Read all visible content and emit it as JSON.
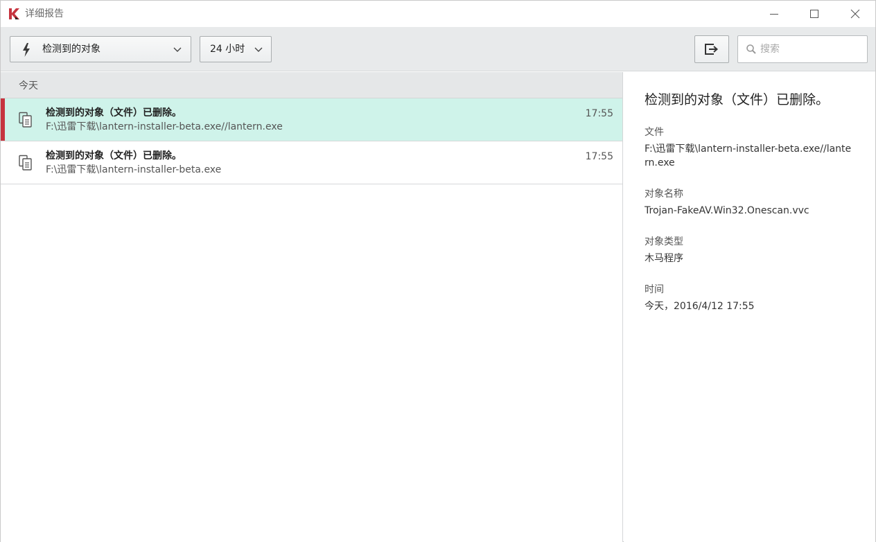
{
  "window": {
    "title": "详细报告",
    "colors": {
      "logo_red": "#c6343f",
      "selection": "#cff3ea",
      "toolbar": "#e8eaeb"
    }
  },
  "toolbar": {
    "type_filter": {
      "icon": "lightning-bolt-icon",
      "label": "检测到的对象"
    },
    "time_filter": {
      "label": "24 小时"
    },
    "export_icon": "export-icon",
    "search": {
      "placeholder": "搜索",
      "value": ""
    }
  },
  "list": {
    "group_label": "今天",
    "rows": [
      {
        "title": "检测到的对象（文件）已删除。",
        "path": "F:\\迅雷下载\\lantern-installer-beta.exe//lantern.exe",
        "time": "17:55",
        "selected": true
      },
      {
        "title": "检测到的对象（文件）已删除。",
        "path": "F:\\迅雷下载\\lantern-installer-beta.exe",
        "time": "17:55",
        "selected": false
      }
    ]
  },
  "details": {
    "title": "检测到的对象（文件）已删除。",
    "file_label": "文件",
    "file_value": "F:\\迅雷下载\\lantern-installer-beta.exe//lantern.exe",
    "object_name_label": "对象名称",
    "object_name_value": "Trojan-FakeAV.Win32.Onescan.vvc",
    "object_type_label": "对象类型",
    "object_type_value": "木马程序",
    "time_label": "时间",
    "time_value": "今天，2016/4/12 17:55"
  }
}
